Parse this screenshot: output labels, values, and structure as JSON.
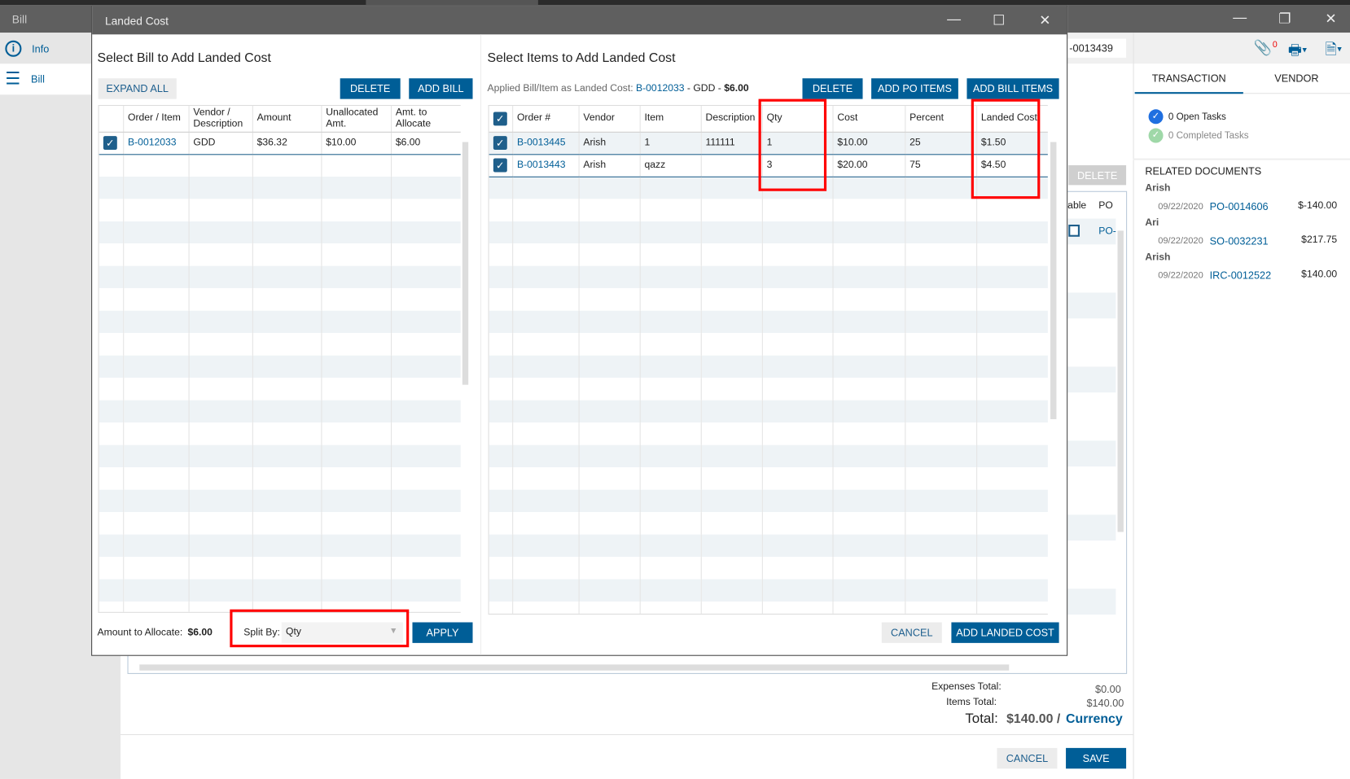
{
  "app": {
    "title": "Bill",
    "bill_number": "-0013439",
    "attachment_count": "0"
  },
  "sidebar": {
    "items": [
      {
        "label": "Info"
      },
      {
        "label": "Bill"
      }
    ]
  },
  "right_panel": {
    "tabs": [
      "TRANSACTION",
      "VENDOR"
    ],
    "open_tasks": "0 Open Tasks",
    "completed_tasks": "0 Completed Tasks",
    "related_title": "RELATED DOCUMENTS",
    "related": [
      {
        "name": "Arish",
        "date": "09/22/2020",
        "doc": "PO-0014606",
        "amount": "$-140.00"
      },
      {
        "name": "Ari",
        "date": "09/22/2020",
        "doc": "SO-0032231",
        "amount": "$217.75"
      },
      {
        "name": "Arish",
        "date": "09/22/2020",
        "doc": "IRC-0012522",
        "amount": "$140.00"
      }
    ]
  },
  "background": {
    "delete_label": "DELETE",
    "col_partial": "able",
    "col_po": "PO",
    "row_po": "PO-",
    "expenses_label": "Expenses Total:",
    "expenses_value": "$0.00",
    "items_label": "Items Total:",
    "items_value": "$140.00",
    "total_label": "Total:",
    "total_value": "$140.00 /",
    "currency": "Currency",
    "cancel": "CANCEL",
    "save": "SAVE"
  },
  "dialog": {
    "title": "Landed Cost",
    "left": {
      "title": "Select Bill to Add Landed Cost",
      "expand_all": "EXPAND ALL",
      "delete": "DELETE",
      "add_bill": "ADD BILL",
      "columns": [
        "Order / Item",
        "Vendor / Description",
        "Amount",
        "Unallocated Amt.",
        "Amt. to Allocate"
      ],
      "rows": [
        {
          "order": "B-0012033",
          "vendor": "GDD",
          "amount": "$36.32",
          "unallocated": "$10.00",
          "allocate": "$6.00"
        }
      ],
      "amount_label": "Amount to Allocate:",
      "amount_value": "$6.00",
      "split_label": "Split By:",
      "split_value": "Qty",
      "apply": "APPLY"
    },
    "right": {
      "title": "Select Items to Add Landed Cost",
      "applied_label": "Applied Bill/Item as Landed Cost:",
      "applied_bill": "B-0012033",
      "applied_vendor": "GDD",
      "applied_amount": "$6.00",
      "delete": "DELETE",
      "add_po_items": "ADD PO ITEMS",
      "add_bill_items": "ADD BILL ITEMS",
      "columns": [
        "Order #",
        "Vendor",
        "Item",
        "Description",
        "Qty",
        "Cost",
        "Percent",
        "Landed Cost"
      ],
      "rows": [
        {
          "order": "B-0013445",
          "vendor": "Arish",
          "item": "1",
          "description": "111111",
          "qty": "1",
          "cost": "$10.00",
          "percent": "25",
          "landed": "$1.50"
        },
        {
          "order": "B-0013443",
          "vendor": "Arish",
          "item": "qazz",
          "description": "",
          "qty": "3",
          "cost": "$20.00",
          "percent": "75",
          "landed": "$4.50"
        }
      ],
      "cancel": "CANCEL",
      "add_landed_cost": "ADD LANDED COST"
    }
  }
}
